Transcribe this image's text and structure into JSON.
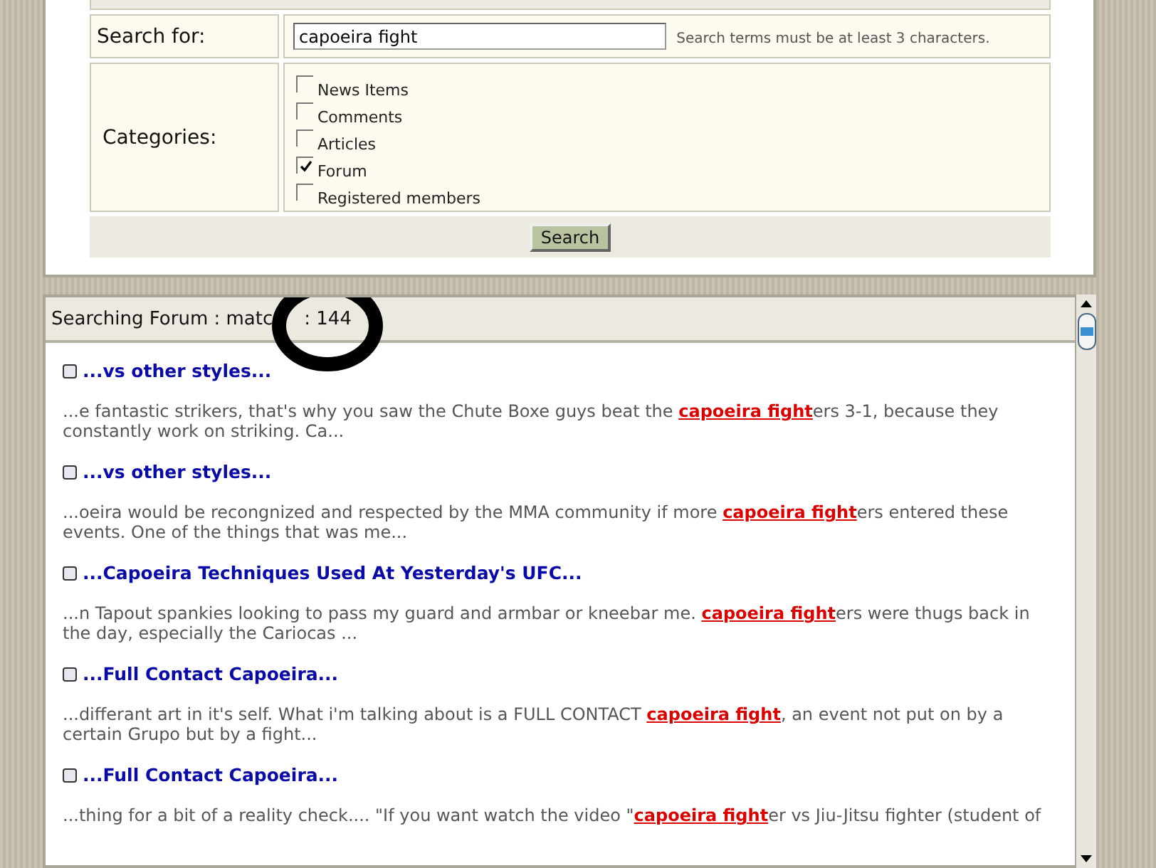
{
  "search_form": {
    "query_label": "Search for:",
    "query": "capoeira fight",
    "hint": "Search terms must be at least 3 characters.",
    "categories_label": "Categories:",
    "categories": [
      {
        "label": "News Items",
        "checked": false
      },
      {
        "label": "Comments",
        "checked": false
      },
      {
        "label": "Articles",
        "checked": false
      },
      {
        "label": "Forum",
        "checked": true
      },
      {
        "label": "Registered members",
        "checked": false
      }
    ],
    "button": "Search"
  },
  "results": {
    "heading": "Searching Forum : matc",
    "count": ": 144",
    "items": [
      {
        "title": "...vs other styles...",
        "before": "...e fantastic strikers, that's why you saw the Chute Boxe guys beat the ",
        "match": "capoeira fight",
        "after": "ers 3-1, because they constantly work on striking. Ca..."
      },
      {
        "title": "...vs other styles...",
        "before": "...oeira would be recongnized and respected by the MMA community if more ",
        "match": "capoeira fight",
        "after": "ers entered these events. One of the things that was me..."
      },
      {
        "title": "...Capoeira Techniques Used At Yesterday's UFC...",
        "before": "...n Tapout spankies looking to pass my guard and armbar or kneebar me. ",
        "match": "capoeira fight",
        "after": "ers were thugs back in the day, especially the Cariocas ..."
      },
      {
        "title": "...Full Contact Capoeira...",
        "before": "...differant art in it's self. What i'm talking about is a FULL CONTACT ",
        "match": "capoeira fight",
        "after": ", an event not put on by a certain Grupo but by a fight..."
      },
      {
        "title": "...Full Contact Capoeira...",
        "before": "...thing for a bit of a reality check.... \"If you want watch the video \"",
        "match": "capoeira fight",
        "after": "er vs Jiu-Jitsu fighter (student of"
      }
    ]
  }
}
